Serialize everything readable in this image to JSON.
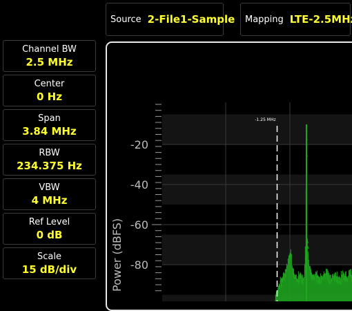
{
  "header": {
    "source": {
      "label": "Source",
      "value": "2-File1-Sample"
    },
    "mapping": {
      "label": "Mapping",
      "value": "LTE-2.5MHz"
    }
  },
  "params": [
    {
      "label": "Channel BW",
      "value": "2.5 MHz"
    },
    {
      "label": "Center",
      "value": "0 Hz"
    },
    {
      "label": "Span",
      "value": "3.84 MHz"
    },
    {
      "label": "RBW",
      "value": "234.375 Hz"
    },
    {
      "label": "VBW",
      "value": "4 MHz"
    },
    {
      "label": "Ref Level",
      "value": "0 dB"
    },
    {
      "label": "Scale",
      "value": "15 dB/div"
    }
  ],
  "colors": {
    "accent": "#ffff2e",
    "trace": "#1fa51f",
    "band": "#141414",
    "grid": "#3a3a3a"
  },
  "chart_data": {
    "type": "line",
    "ylabel": "Power (dBFS)",
    "ylim": [
      -95,
      0
    ],
    "yticks": [
      -20,
      -40,
      -60,
      -80
    ],
    "xlim": [
      -1.92,
      -0.8
    ],
    "marker": {
      "label": "-1.25 MHz",
      "x": -1.25
    },
    "series": [
      {
        "name": "",
        "x": [
          -1.92,
          -1.88,
          -1.8,
          -1.7,
          -1.6,
          -1.5,
          -1.4,
          -1.33,
          -1.29,
          -1.27,
          -1.25,
          -1.23,
          -1.21,
          -1.19,
          -1.17,
          -1.15,
          -1.13,
          -1.12,
          -1.11,
          -1.1,
          -1.09,
          -1.08,
          -1.075,
          -1.07,
          -1.06,
          -1.04,
          -1.02,
          -1.0,
          -0.98,
          -0.96,
          -0.94,
          -0.92,
          -0.9,
          -0.88,
          -0.86,
          -0.84,
          -0.82,
          -0.8
        ],
        "y": [
          -135,
          -135,
          -135,
          -135,
          -135,
          -135,
          -135,
          -132,
          -110,
          -100,
          -93,
          -88,
          -85,
          -80,
          -72,
          -84,
          -86,
          -85,
          -84,
          -86,
          -86,
          -70,
          -10,
          -66,
          -80,
          -85,
          -84,
          -86,
          -85,
          -83,
          -86,
          -84,
          -85,
          -86,
          -84,
          -85,
          -83,
          -85
        ]
      }
    ]
  }
}
